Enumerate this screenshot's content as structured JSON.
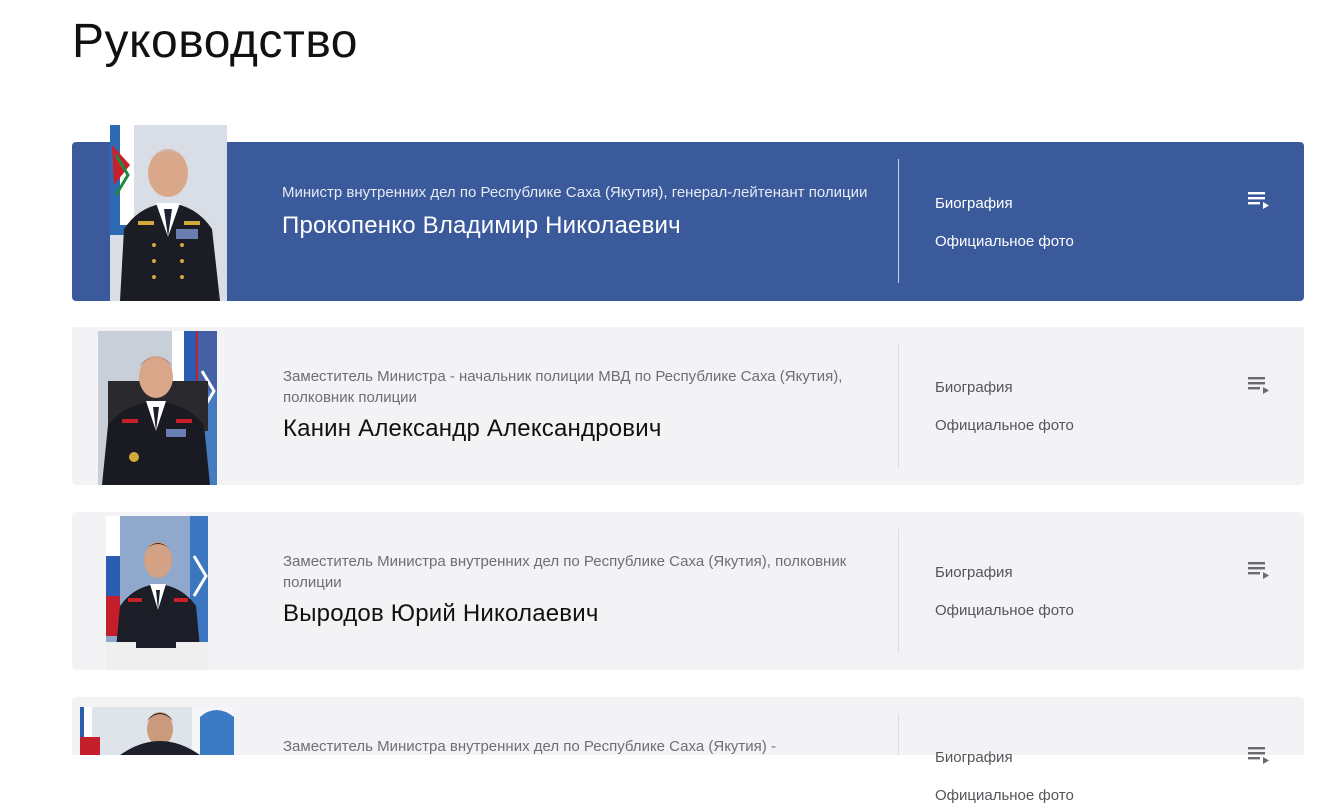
{
  "page": {
    "title": "Руководство"
  },
  "leaders": [
    {
      "position": "Министр внутренних дел по Республике Саха (Якутия), генерал-лейтенант полиции",
      "name": "Прокопенко Владимир Николаевич",
      "biography_label": "Биография",
      "photo_label": "Официальное фото",
      "icon": "playlist-icon",
      "active": true
    },
    {
      "position": "Заместитель Министра - начальник полиции МВД по Республике Саха (Якутия), полковник полиции",
      "name": "Канин Александр Александрович",
      "biography_label": "Биография",
      "photo_label": "Официальное фото",
      "icon": "playlist-icon",
      "active": false
    },
    {
      "position": "Заместитель Министра внутренних дел по Республике Саха (Якутия), полковник полиции",
      "name": "Выродов Юрий Николаевич",
      "biography_label": "Биография",
      "photo_label": "Официальное фото",
      "icon": "playlist-icon",
      "active": false
    },
    {
      "position": "Заместитель Министра внутренних дел по Республике Саха (Якутия) -",
      "name": "",
      "biography_label": "Биография",
      "photo_label": "Официальное фото",
      "icon": "playlist-icon",
      "active": false
    }
  ],
  "colors": {
    "active_card": "#3a5a9c",
    "card": "#f3f3f5",
    "title": "#111111",
    "muted_text": "#6e6e73"
  }
}
